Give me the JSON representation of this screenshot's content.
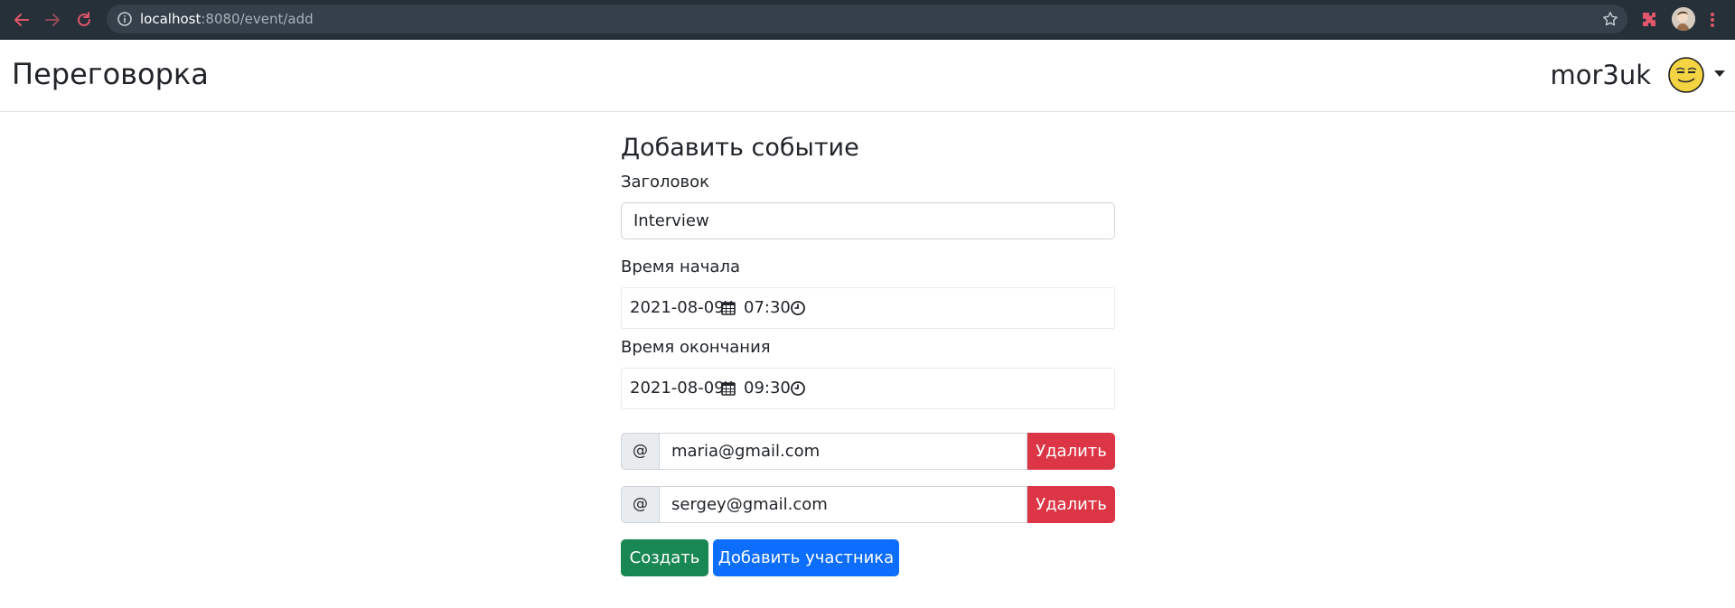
{
  "browser": {
    "url_host": "localhost",
    "url_rest": ":8080/event/add"
  },
  "navbar": {
    "brand": "Переговорка",
    "username": "mor3uk"
  },
  "form": {
    "title": "Добавить событие",
    "title_label": "Заголовок",
    "title_value": "Interview",
    "start_label": "Время начала",
    "start_date": "2021-08-09",
    "start_time": "07:30",
    "end_label": "Время окончания",
    "end_date": "2021-08-09",
    "end_time": "09:30",
    "participants": [
      {
        "addon": "@",
        "email": "maria@gmail.com",
        "remove_label": "Удалить"
      },
      {
        "addon": "@",
        "email": "sergey@gmail.com",
        "remove_label": "Удалить"
      }
    ],
    "create_label": "Создать",
    "add_participant_label": "Добавить участника"
  },
  "colors": {
    "danger": "#dc3545",
    "success": "#198754",
    "primary": "#0d6efd",
    "chrome": "#263039",
    "nav_icon": "#e2566b"
  },
  "icons": [
    "back-arrow-icon",
    "forward-arrow-icon",
    "reload-icon",
    "info-icon",
    "star-icon",
    "extension-puzzle-icon",
    "profile-avatar-icon",
    "menu-dots-icon",
    "smiley-avatar-icon",
    "calendar-icon",
    "clock-icon"
  ]
}
